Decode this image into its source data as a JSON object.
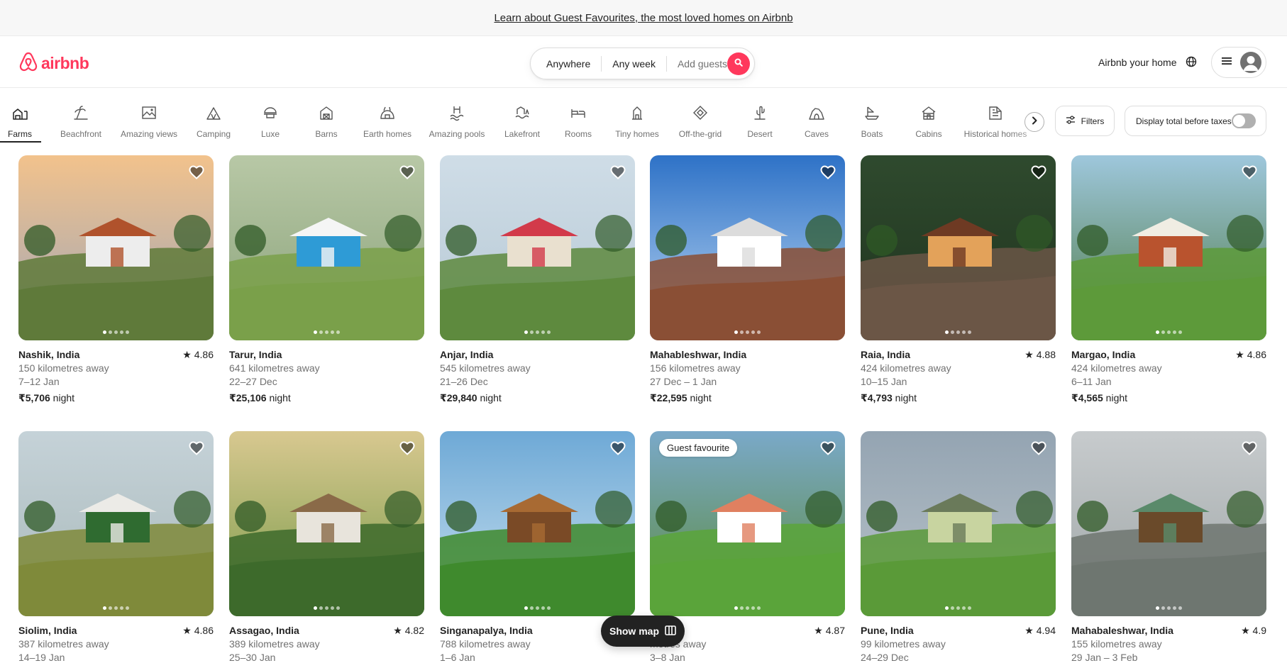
{
  "banner": {
    "text": "Learn about Guest Favourites, the most loved homes on Airbnb"
  },
  "header": {
    "logo_text": "airbnb",
    "search": {
      "location": "Anywhere",
      "dates": "Any week",
      "guests": "Add guests"
    },
    "host_link": "Airbnb your home",
    "icons": [
      "airbnb-logo-icon",
      "search-icon",
      "globe-icon",
      "menu-icon",
      "user-avatar-icon"
    ]
  },
  "categories": {
    "items": [
      {
        "label": "Farms",
        "icon": "farms-icon",
        "active": true
      },
      {
        "label": "Beachfront",
        "icon": "beachfront-icon"
      },
      {
        "label": "Amazing views",
        "icon": "amazing-views-icon"
      },
      {
        "label": "Camping",
        "icon": "camping-icon"
      },
      {
        "label": "Luxe",
        "icon": "luxe-icon"
      },
      {
        "label": "Barns",
        "icon": "barns-icon"
      },
      {
        "label": "Earth homes",
        "icon": "earth-homes-icon"
      },
      {
        "label": "Amazing pools",
        "icon": "amazing-pools-icon"
      },
      {
        "label": "Lakefront",
        "icon": "lakefront-icon"
      },
      {
        "label": "Rooms",
        "icon": "rooms-icon"
      },
      {
        "label": "Tiny homes",
        "icon": "tiny-homes-icon"
      },
      {
        "label": "Off-the-grid",
        "icon": "off-the-grid-icon"
      },
      {
        "label": "Desert",
        "icon": "desert-icon"
      },
      {
        "label": "Caves",
        "icon": "caves-icon"
      },
      {
        "label": "Boats",
        "icon": "boats-icon"
      },
      {
        "label": "Cabins",
        "icon": "cabins-icon"
      },
      {
        "label": "Historical homes",
        "icon": "historical-homes-icon"
      }
    ],
    "filters_label": "Filters",
    "taxes_label": "Display total before taxes",
    "taxes_on": false
  },
  "listings": [
    {
      "title": "Nashik, India",
      "rating": "4.86",
      "distance": "150 kilometres away",
      "dates": "7–12 Jan",
      "price": "₹5,706",
      "unit": "night"
    },
    {
      "title": "Tarur, India",
      "rating": "",
      "distance": "641 kilometres away",
      "dates": "22–27 Dec",
      "price": "₹25,106",
      "unit": "night"
    },
    {
      "title": "Anjar, India",
      "rating": "",
      "distance": "545 kilometres away",
      "dates": "21–26 Dec",
      "price": "₹29,840",
      "unit": "night"
    },
    {
      "title": "Mahableshwar, India",
      "rating": "",
      "distance": "156 kilometres away",
      "dates": "27 Dec – 1 Jan",
      "price": "₹22,595",
      "unit": "night"
    },
    {
      "title": "Raia, India",
      "rating": "4.88",
      "distance": "424 kilometres away",
      "dates": "10–15 Jan",
      "price": "₹4,793",
      "unit": "night"
    },
    {
      "title": "Margao, India",
      "rating": "4.86",
      "distance": "424 kilometres away",
      "dates": "6–11 Jan",
      "price": "₹4,565",
      "unit": "night"
    },
    {
      "title": "Siolim, India",
      "rating": "4.86",
      "distance": "387 kilometres away",
      "dates": "14–19 Jan",
      "price": "",
      "unit": ""
    },
    {
      "title": "Assagao, India",
      "rating": "4.82",
      "distance": "389 kilometres away",
      "dates": "25–30 Jan",
      "price": "",
      "unit": ""
    },
    {
      "title": "Singanapalya, India",
      "rating": "",
      "distance": "788 kilometres away",
      "dates": "1–6 Jan",
      "price": "",
      "unit": ""
    },
    {
      "title": "India",
      "rating": "4.87",
      "distance": "metres away",
      "dates": "3–8 Jan",
      "price": "",
      "unit": "",
      "badge": "Guest favourite"
    },
    {
      "title": "Pune, India",
      "rating": "4.94",
      "distance": "99 kilometres away",
      "dates": "24–29 Dec",
      "price": "",
      "unit": ""
    },
    {
      "title": "Mahabaleshwar, India",
      "rating": "4.9",
      "distance": "155 kilometres away",
      "dates": "29 Jan – 3 Feb",
      "price": "",
      "unit": ""
    }
  ],
  "show_map_label": "Show map",
  "colors": {
    "brand": "#FF385C",
    "text": "#222222",
    "muted": "#717171",
    "border": "#DDDDDD"
  }
}
